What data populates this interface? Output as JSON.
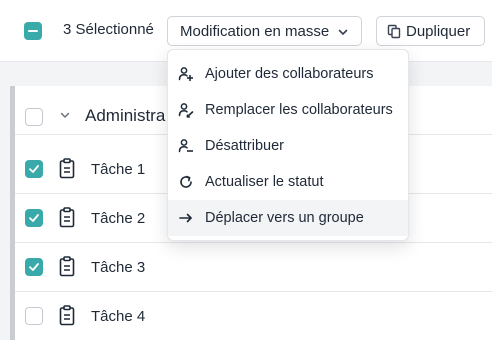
{
  "toolbar": {
    "selected_count": "3 Sélectionné",
    "bulk_edit_label": "Modification en masse",
    "duplicate_label": "Dupliquer"
  },
  "bulk_menu": {
    "items": [
      {
        "label": "Ajouter des collaborateurs",
        "icon": "add-person-icon"
      },
      {
        "label": "Remplacer les collaborateurs",
        "icon": "replace-person-icon"
      },
      {
        "label": "Désattribuer",
        "icon": "remove-person-icon"
      },
      {
        "label": "Actualiser le statut",
        "icon": "refresh-icon"
      },
      {
        "label": "Déplacer vers un groupe",
        "icon": "arrow-right-icon"
      }
    ],
    "highlighted_index": 4
  },
  "group": {
    "title": "Administra",
    "checked": false
  },
  "tasks": [
    {
      "label": "Tâche 1",
      "checked": true
    },
    {
      "label": "Tâche 2",
      "checked": true
    },
    {
      "label": "Tâche 3",
      "checked": true
    },
    {
      "label": "Tâche 4",
      "checked": false
    }
  ],
  "colors": {
    "accent": "#3aa9a9",
    "border": "#e5e7eb",
    "text": "#1f2937"
  }
}
